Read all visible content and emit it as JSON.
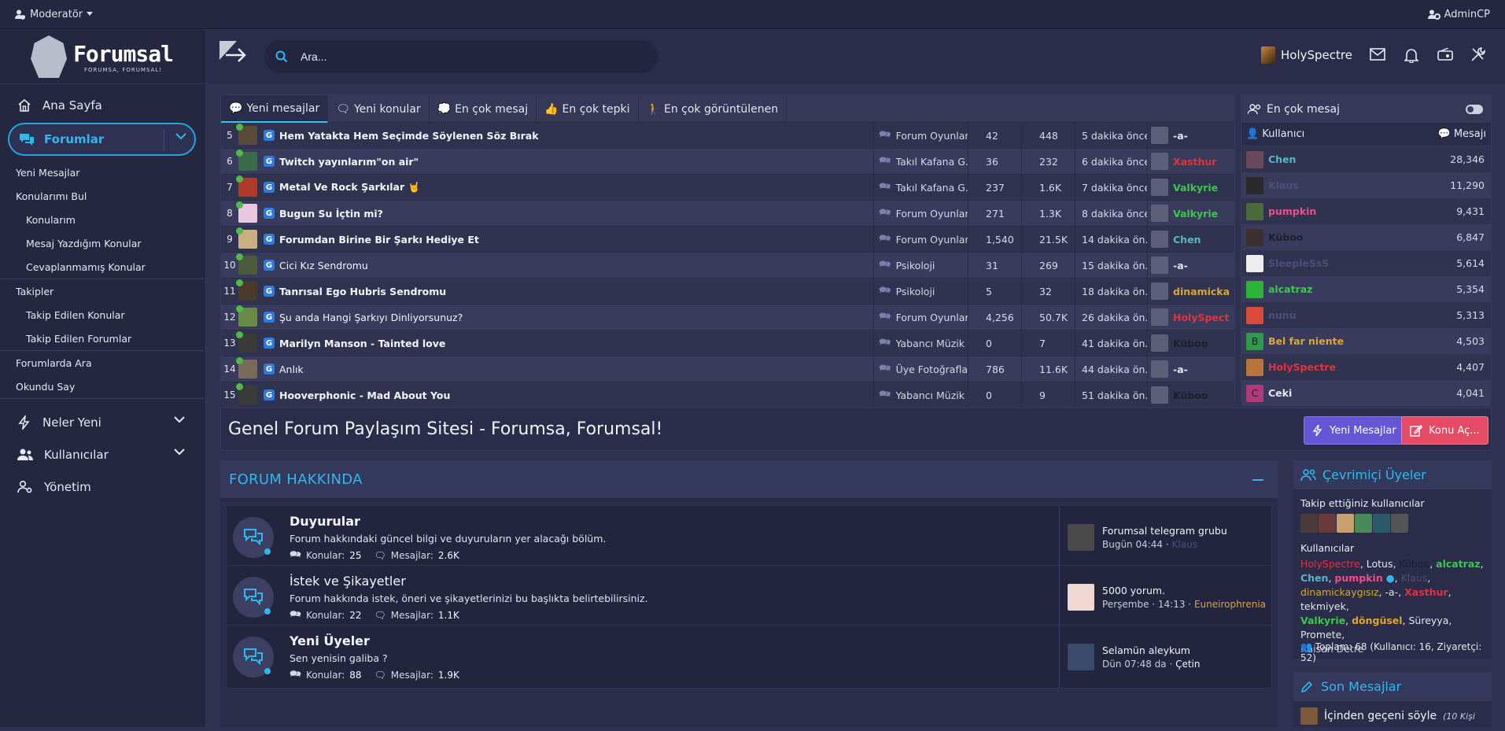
{
  "topbar": {
    "moderator": "Moderatör",
    "admincp": "AdminCP"
  },
  "logo": {
    "title": "Forumsal",
    "tagline": "FORUMSA, FORUMSAL!"
  },
  "sidebar": {
    "home": "Ana Sayfa",
    "forums": "Forumlar",
    "sub": [
      "Yeni Mesajlar",
      "Konularımı Bul",
      "Konularım",
      "Mesaj Yazdığım Konular",
      "Cevaplanmamış Konular",
      "Takipler",
      "Takip Edilen Konular",
      "Takip Edilen Forumlar",
      "Forumlarda Ara",
      "Okundu Say"
    ],
    "whats_new": "Neler Yeni",
    "members": "Kullanıcılar",
    "admin": "Yönetim"
  },
  "header": {
    "search_placeholder": "Ara...",
    "username": "HolySpectre"
  },
  "recent": {
    "tabs": [
      "Yeni mesajlar",
      "Yeni konular",
      "En çok mesaj",
      "En çok tepki",
      "En çok görüntülenen"
    ],
    "rows": [
      {
        "n": "5",
        "title": "Hem Yatakta Hem Seçimde Söylenen Söz Bırak",
        "bold": true,
        "forum": "Forum Oyunları",
        "replies": "42",
        "views": "448",
        "time": "5 dakika önce",
        "user": "-a-",
        "ucolor": "#e4e6f0"
      },
      {
        "n": "6",
        "title": "Twitch yayınlarım\"on air\"",
        "bold": true,
        "forum": "Takıl Kafana G...",
        "replies": "36",
        "views": "232",
        "time": "6 dakika önce",
        "user": "Xasthur",
        "ucolor": "#e5313c"
      },
      {
        "n": "7",
        "title": "Metal Ve Rock Şarkılar 🤘",
        "bold": true,
        "forum": "Takıl Kafana G...",
        "replies": "237",
        "views": "1.6K",
        "time": "7 dakika önce",
        "user": "Valkyrie",
        "ucolor": "#3bc84b"
      },
      {
        "n": "8",
        "title": "Bugun Su İçtin mi?",
        "bold": true,
        "forum": "Forum Oyunları",
        "replies": "271",
        "views": "1.3K",
        "time": "8 dakika önce",
        "user": "Valkyrie",
        "ucolor": "#3bc84b"
      },
      {
        "n": "9",
        "title": "Forumdan Birine Bir Şarkı Hediye Et",
        "bold": true,
        "forum": "Forum Oyunları",
        "replies": "1,540",
        "views": "21.5K",
        "time": "14 dakika ön...",
        "user": "Chen",
        "ucolor": "#58b6c5"
      },
      {
        "n": "10",
        "title": "Cici Kız Sendromu",
        "bold": false,
        "forum": "Psikoloji",
        "replies": "31",
        "views": "269",
        "time": "15 dakika ön...",
        "user": "-a-",
        "ucolor": "#e4e6f0"
      },
      {
        "n": "11",
        "title": "Tanrısal Ego Hubris Sendromu",
        "bold": true,
        "forum": "Psikoloji",
        "replies": "5",
        "views": "32",
        "time": "18 dakika ön...",
        "user": "dinamickay...",
        "ucolor": "#d8a73a"
      },
      {
        "n": "12",
        "title": "Şu anda Hangi Şarkıyı Dinliyorsunuz?",
        "bold": false,
        "forum": "Forum Oyunları",
        "replies": "4,256",
        "views": "50.7K",
        "time": "26 dakika ön...",
        "user": "HolySpectre",
        "ucolor": "#e5313c"
      },
      {
        "n": "13",
        "title": "Marilyn Manson - Tainted love",
        "bold": true,
        "forum": "Yabancı Müzik",
        "replies": "0",
        "views": "7",
        "time": "41 dakika ön...",
        "user": "Küboo",
        "ucolor": "#1d1f2e"
      },
      {
        "n": "14",
        "title": "Anlık",
        "bold": false,
        "forum": "Üye Fotoğrafları",
        "replies": "786",
        "views": "11.6K",
        "time": "44 dakika ön...",
        "user": "-a-",
        "ucolor": "#e4e6f0"
      },
      {
        "n": "15",
        "title": "Hooverphonic - Mad About You",
        "bold": true,
        "forum": "Yabancı Müzik",
        "replies": "0",
        "views": "9",
        "time": "51 dakika ön...",
        "user": "Küboo",
        "ucolor": "#1d1f2e"
      }
    ]
  },
  "top_posters": {
    "title": "En çok mesaj",
    "col_user": "Kullanıcı",
    "col_msgs": "Mesajı",
    "rows": [
      {
        "name": "Chen",
        "count": "28,346",
        "color": "#58b6c5",
        "bg": "#6a4a5a"
      },
      {
        "name": "Klaus",
        "count": "11,290",
        "color": "#4b4f7a",
        "bg": "#2a2a2a"
      },
      {
        "name": "pumpkin",
        "count": "9,431",
        "color": "#f04c8c",
        "bg": "#4a6a3a"
      },
      {
        "name": "Küboo",
        "count": "6,847",
        "color": "#1d1f2e",
        "bg": "#3a3030"
      },
      {
        "name": "SleepleSsS",
        "count": "5,614",
        "color": "#4b4f7a",
        "bg": "#eeeeee"
      },
      {
        "name": "alcatraz",
        "count": "5,354",
        "color": "#3bc84b",
        "bg": "#2bb33a"
      },
      {
        "name": "nunu",
        "count": "5,313",
        "color": "#4b4f7a",
        "bg": "#d94a3a"
      },
      {
        "name": "Bel far niente",
        "count": "4,503",
        "color": "#d8a73a",
        "bg": "#2e9a4a",
        "letter": "B"
      },
      {
        "name": "HolySpectre",
        "count": "4,407",
        "color": "#e5313c",
        "bg": "#b8743a"
      },
      {
        "name": "Ceki",
        "count": "4,041",
        "color": "#e4e6f0",
        "bg": "#b03a7a",
        "letter": "C"
      }
    ]
  },
  "banner": {
    "title": "Genel Forum Paylaşım Sitesi - Forumsa, Forumsal!",
    "new_posts_btn": "Yeni Mesajlar",
    "new_thread_btn": "Konu Aç..."
  },
  "category": {
    "title": "FORUM HAKKINDA",
    "nodes": [
      {
        "title": "Duyurular",
        "bold": true,
        "desc": "Forum hakkındaki güncel bilgi ve duyuruların yer alacağı bölüm.",
        "threads_label": "Konular:",
        "threads": "25",
        "msgs_label": "Mesajlar:",
        "msgs": "2.6K",
        "last_title": "Forumsal telegram grubu",
        "last_meta": "Bugün 04:44 ·",
        "last_user": "Klaus",
        "last_color": "#4b4f7a"
      },
      {
        "title": "İstek ve Şikayetler",
        "bold": false,
        "desc": "Forum hakkında istek, öneri ve şikayetlerinizi bu başlıkta belirtebilirsiniz.",
        "threads_label": "Konular:",
        "threads": "22",
        "msgs_label": "Mesajlar:",
        "msgs": "1.1K",
        "last_title": "5000 yorum.",
        "last_meta": "Perşembe · 14:13 ·",
        "last_user": "Euneirophrenia",
        "last_color": "#d8a73a"
      },
      {
        "title": "Yeni Üyeler",
        "bold": true,
        "desc": "Sen yenisin galiba ?",
        "threads_label": "Konular:",
        "threads": "88",
        "msgs_label": "Mesajlar:",
        "msgs": "1.9K",
        "last_title": "Selamün aleykum",
        "last_meta": "Dün 07:48 da ·",
        "last_user": "Çetin",
        "last_color": "#f4f5fb"
      }
    ]
  },
  "online": {
    "title": "Çevrimiçi Üyeler",
    "following": "Takip ettiğiniz kullanıcılar",
    "members_label": "Kullanıcılar",
    "total": "Toplam: 68 (Kullanıcı: 16, Ziyaretçi: 52)"
  },
  "last_messages": {
    "title": "Son Mesajlar",
    "item": "İçinden geçeni söyle",
    "item_meta": "(10 Kişi"
  }
}
